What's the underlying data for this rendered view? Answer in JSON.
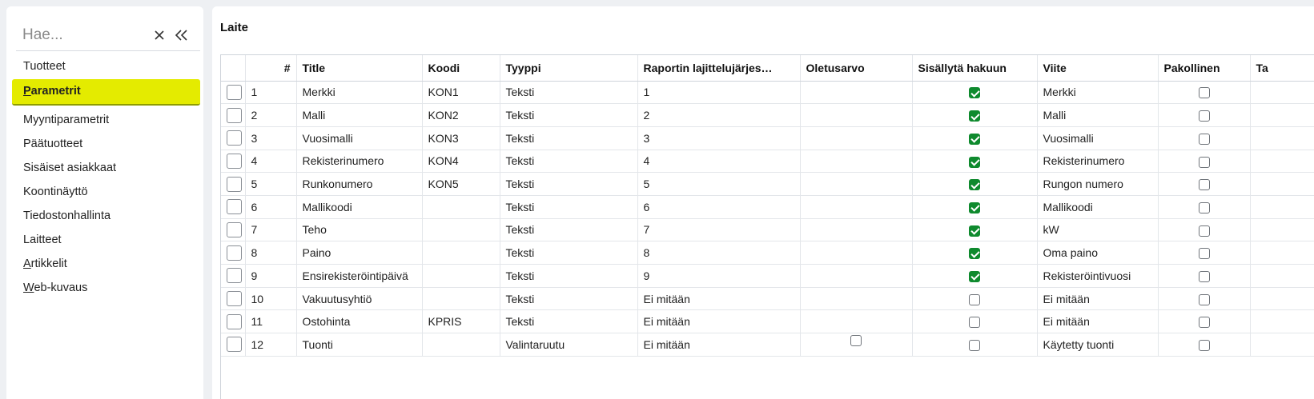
{
  "sidebar": {
    "search_placeholder": "Hae...",
    "clear_icon": "close-icon",
    "collapse_icon": "double-chevron-left-icon",
    "items": [
      {
        "label": "Tuotteet"
      },
      {
        "mnemonic": "P",
        "rest": "arametrit",
        "active": true
      },
      {
        "label": "Myyntiparametrit"
      },
      {
        "label": "Päätuotteet"
      },
      {
        "label": "Sisäiset asiakkaat"
      },
      {
        "label": "Koontinäyttö"
      },
      {
        "label": "Tiedostonhallinta"
      },
      {
        "label": "Laitteet"
      },
      {
        "mnemonic": "A",
        "rest": "rtikkelit"
      },
      {
        "mnemonic": "W",
        "rest": "eb-kuvaus"
      }
    ],
    "accent_color": "#e4eb00"
  },
  "main": {
    "title": "Laite",
    "columns": [
      "#",
      "Title",
      "Koodi",
      "Tyyppi",
      "Raportin lajittelujärjes…",
      "Oletusarvo",
      "Sisällytä hakuun",
      "Viite",
      "Pakollinen",
      "Ta"
    ],
    "rows": [
      {
        "n": "1",
        "title": "Merkki",
        "koodi": "KON1",
        "tyyppi": "Teksti",
        "raportti": "1",
        "haku": true,
        "viite": "Merkki",
        "pakollinen": false
      },
      {
        "n": "2",
        "title": "Malli",
        "koodi": "KON2",
        "tyyppi": "Teksti",
        "raportti": "2",
        "haku": true,
        "viite": "Malli",
        "pakollinen": false
      },
      {
        "n": "3",
        "title": "Vuosimalli",
        "koodi": "KON3",
        "tyyppi": "Teksti",
        "raportti": "3",
        "haku": true,
        "viite": "Vuosimalli",
        "pakollinen": false
      },
      {
        "n": "4",
        "title": "Rekisterinumero",
        "koodi": "KON4",
        "tyyppi": "Teksti",
        "raportti": "4",
        "haku": true,
        "viite": "Rekisterinumero",
        "pakollinen": false
      },
      {
        "n": "5",
        "title": "Runkonumero",
        "koodi": "KON5",
        "tyyppi": "Teksti",
        "raportti": "5",
        "haku": true,
        "viite": "Rungon numero",
        "pakollinen": false
      },
      {
        "n": "6",
        "title": "Mallikoodi",
        "koodi": "",
        "tyyppi": "Teksti",
        "raportti": "6",
        "haku": true,
        "viite": "Mallikoodi",
        "pakollinen": false
      },
      {
        "n": "7",
        "title": "Teho",
        "koodi": "",
        "tyyppi": "Teksti",
        "raportti": "7",
        "haku": true,
        "viite": "kW",
        "pakollinen": false
      },
      {
        "n": "8",
        "title": "Paino",
        "koodi": "",
        "tyyppi": "Teksti",
        "raportti": "8",
        "haku": true,
        "viite": "Oma paino",
        "pakollinen": false
      },
      {
        "n": "9",
        "title": "Ensirekisteröintipäivä",
        "koodi": "",
        "tyyppi": "Teksti",
        "raportti": "9",
        "haku": true,
        "viite": "Rekisteröintivuosi",
        "pakollinen": false
      },
      {
        "n": "10",
        "title": "Vakuutusyhtiö",
        "koodi": "",
        "tyyppi": "Teksti",
        "raportti": "Ei mitään",
        "haku": false,
        "viite": "Ei mitään",
        "pakollinen": false
      },
      {
        "n": "11",
        "title": "Ostohinta",
        "koodi": "KPRIS",
        "tyyppi": "Teksti",
        "raportti": "Ei mitään",
        "haku": false,
        "viite": "Ei mitään",
        "pakollinen": false
      },
      {
        "n": "12",
        "title": "Tuonti",
        "koodi": "",
        "tyyppi": "Valintaruutu",
        "raportti": "Ei mitään",
        "oletus_checkbox": false,
        "haku": false,
        "viite": "Käytetty tuonti",
        "pakollinen": false
      }
    ],
    "checked_color": "#0f8a2e"
  }
}
